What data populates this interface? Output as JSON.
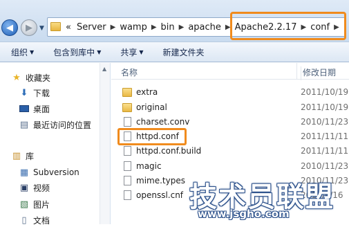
{
  "address": {
    "prefix": "«",
    "crumbs": [
      "Server",
      "wamp",
      "bin",
      "apache",
      "Apache2.2.17",
      "conf"
    ],
    "highlight_color": "#f08b1d"
  },
  "toolbar": {
    "organize": "组织",
    "include_library": "包含到库中",
    "share": "共享",
    "new_folder": "新建文件夹"
  },
  "sidebar": {
    "favorites": "收藏夹",
    "downloads": "下载",
    "desktop": "桌面",
    "recent": "最近访问的位置",
    "library": "库",
    "subversion": "Subversion",
    "videos": "视频",
    "pictures": "图片",
    "documents": "文档"
  },
  "columns": {
    "name": "名称",
    "date": "修改日期"
  },
  "files": [
    {
      "name": "extra",
      "date": "2011/10/19",
      "type": "folder"
    },
    {
      "name": "original",
      "date": "2011/10/19",
      "type": "folder"
    },
    {
      "name": "charset.conv",
      "date": "2010/11/23",
      "type": "file"
    },
    {
      "name": "httpd.conf",
      "date": "2011/11/11",
      "type": "file"
    },
    {
      "name": "httpd.conf.build",
      "date": "2011/11/11",
      "type": "file"
    },
    {
      "name": "magic",
      "date": "2010/11/23",
      "type": "file"
    },
    {
      "name": "mime.types",
      "date": "2010/11/23",
      "type": "file"
    },
    {
      "name": "openssl.cnf",
      "date": "2015/9/16",
      "type": "file"
    }
  ],
  "watermark": {
    "title": "技术员联盟",
    "url": "www.jsgho.com"
  }
}
